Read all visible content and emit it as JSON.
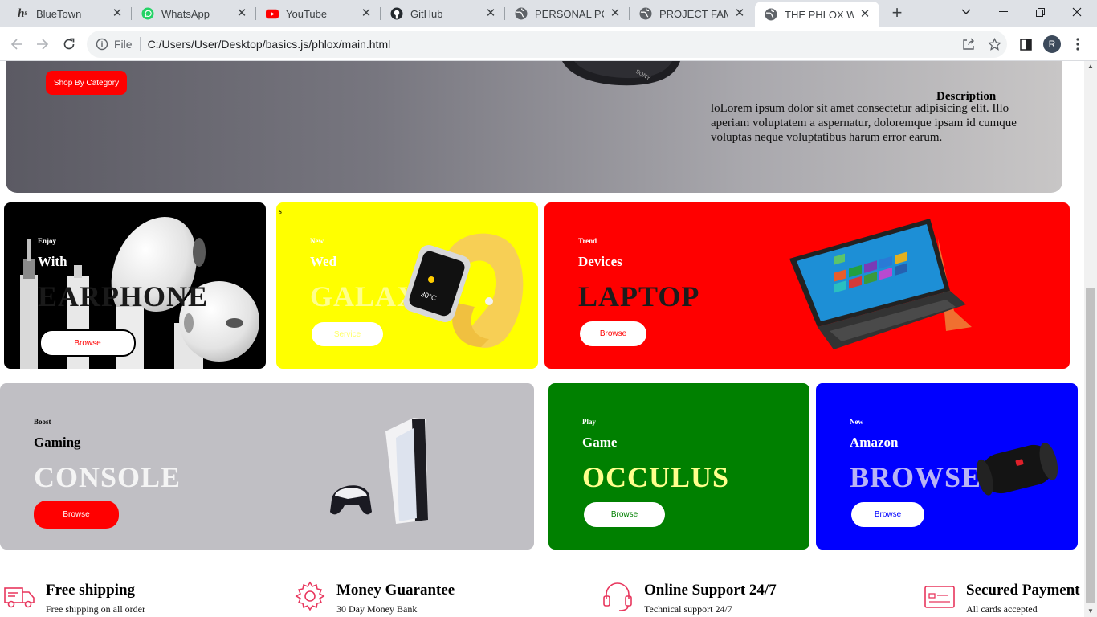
{
  "browser": {
    "tabs": [
      {
        "title": "BlueTown",
        "icon": "hostinger-icon"
      },
      {
        "title": "WhatsApp",
        "icon": "whatsapp-icon"
      },
      {
        "title": "YouTube",
        "icon": "youtube-icon"
      },
      {
        "title": "GitHub",
        "icon": "github-icon"
      },
      {
        "title": "PERSONAL PORT",
        "icon": "globe-icon"
      },
      {
        "title": "PROJECT FAME",
        "icon": "globe-icon"
      },
      {
        "title": "THE PHLOX WEB",
        "icon": "globe-icon",
        "active": true
      }
    ],
    "address": {
      "scheme": "File",
      "url": "C:/Users/User/Desktop/basics.js/phlox/main.html"
    },
    "profile_initial": "R"
  },
  "hero": {
    "shop_button": "Shop By Category",
    "description_heading": "Description",
    "description_text": "loLorem ipsum dolor sit amet consectetur adipisicing elit. Illo aperiam voluptatem a aspernatur, doloremque ipsam id cumque voluptas neque voluptatibus harum error earum."
  },
  "cards": {
    "earphone": {
      "small": "Enjoy",
      "mid": "With",
      "big": "EARPHONE",
      "button": "Browse",
      "bg": "#000000"
    },
    "watch": {
      "stray": "s",
      "small": "New",
      "mid": "Wed",
      "big": "GALAXY",
      "button": "Service",
      "bg": "#ffff00"
    },
    "laptop": {
      "small": "Trend",
      "mid": "Devices",
      "big": "LAPTOP",
      "button": "Browse",
      "bg": "#ff0000"
    },
    "console": {
      "small": "Boost",
      "mid": "Gaming",
      "big": "CONSOLE",
      "button": "Browse",
      "bg": "#c0bfc4"
    },
    "occulus": {
      "small": "Play",
      "mid": "Game",
      "big": "OCCULUS",
      "button": "Browse",
      "bg": "#008000"
    },
    "speaker": {
      "small": "New",
      "mid": "Amazon",
      "big": "BROWSE",
      "button": "Browse",
      "bg": "#0000ff"
    }
  },
  "features": [
    {
      "title": "Free shipping",
      "sub": "Free shipping on all order",
      "icon": "truck-icon"
    },
    {
      "title": "Money Guarantee",
      "sub": "30 Day Money Bank",
      "icon": "gear-icon"
    },
    {
      "title": "Online Support 24/7",
      "sub": "Technical support 24/7",
      "icon": "headset-icon"
    },
    {
      "title": "Secured Payment",
      "sub": "All cards accepted",
      "icon": "credit-card-icon"
    }
  ],
  "colors": {
    "accent": "#ff0000",
    "feature_icon": "#e8365d"
  }
}
